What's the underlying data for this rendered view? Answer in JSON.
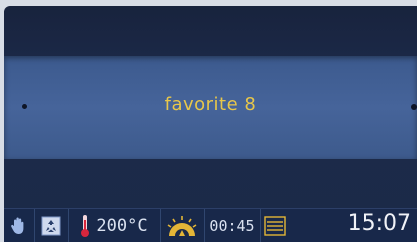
{
  "main": {
    "program_name": "favorite 8"
  },
  "status": {
    "temperature": "200°C",
    "timer": "00:45",
    "clock": "15:07"
  },
  "icons": {
    "hand": "hand-icon",
    "cleaning": "cleaning-icon",
    "thermometer": "thermometer-icon",
    "heat_mode": "heat-mode-icon",
    "levels": "levels-icon"
  },
  "colors": {
    "accent_text": "#e8c74a",
    "band": "#46649a",
    "background": "#1b2a48"
  }
}
